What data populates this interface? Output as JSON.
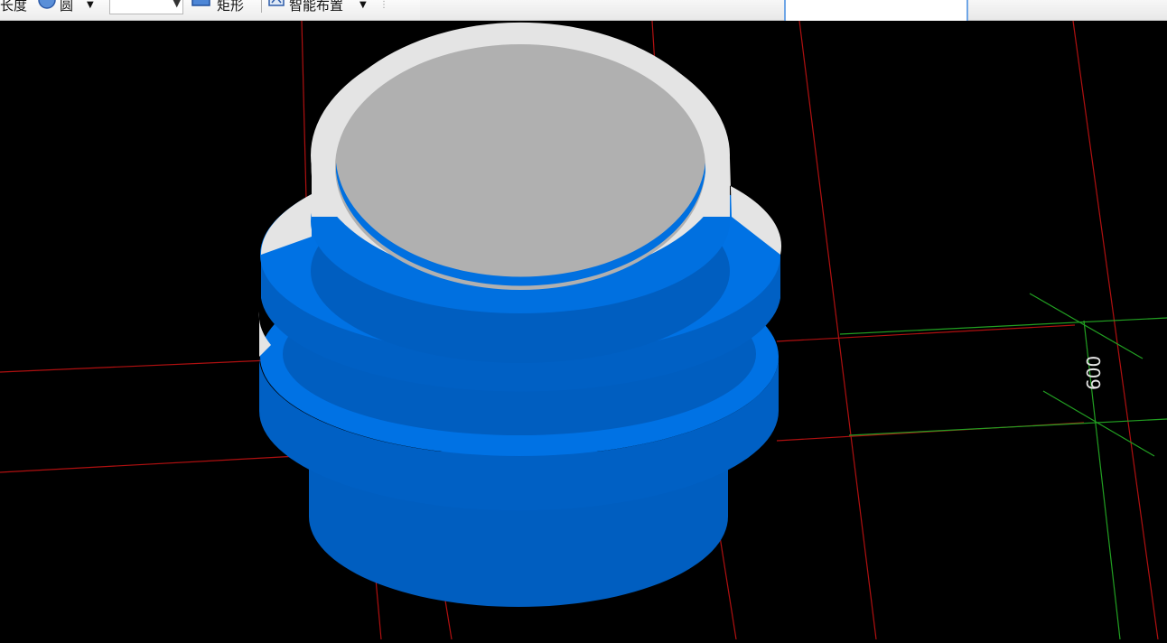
{
  "toolbar": {
    "label_length": "长度",
    "shape_circle": "圆",
    "shape_rect": "矩形",
    "smart_layout": "智能布置"
  },
  "viewport": {
    "dimension_label": "600",
    "colors": {
      "background": "#000000",
      "grid_red": "#b01010",
      "grid_green": "#22a022",
      "ring_blue": "#0070e0",
      "ring_blue_dark": "#005ec0",
      "inner_gray": "#b0b0b0",
      "rim_white": "#e4e4e4"
    }
  }
}
